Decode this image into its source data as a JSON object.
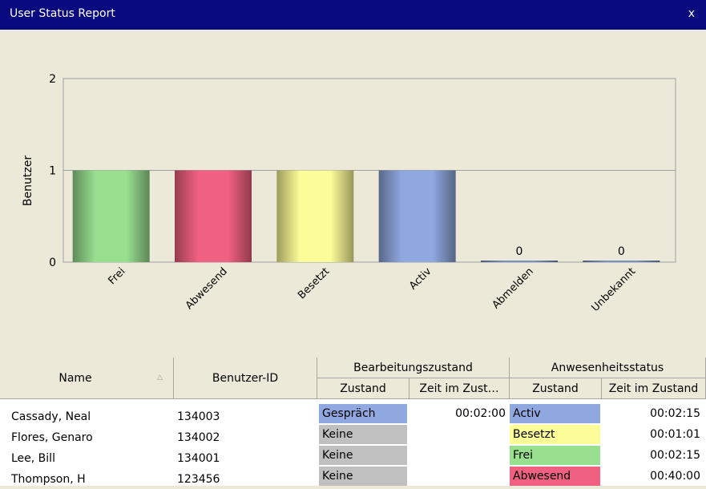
{
  "window": {
    "title": "User Status Report",
    "close_label": "x"
  },
  "chart_data": {
    "type": "bar",
    "categories": [
      "Frei",
      "Abwesend",
      "Besetzt",
      "Activ",
      "Abmelden",
      "Unbekannt"
    ],
    "values": [
      1,
      1,
      1,
      1,
      0,
      0
    ],
    "colors": [
      "#98e090",
      "#f06080",
      "#fcfc98",
      "#90a8e0",
      "#7890c0",
      "#7890c0"
    ],
    "data_labels": [
      "",
      "",
      "",
      "",
      "0",
      "0"
    ],
    "ylabel": "Benutzer",
    "ylim": [
      0,
      2
    ],
    "yticks": [
      "0",
      "1",
      "2"
    ],
    "grid": true
  },
  "table": {
    "headers": {
      "name": "Name",
      "user_id": "Benutzer-ID",
      "group_processing": "Bearbeitungszustand",
      "group_presence": "Anwesenheitsstatus",
      "state": "Zustand",
      "time_in_state_truncated": "Zeit im Zust…",
      "presence_state": "Zustand",
      "presence_time": "Zeit im Zustand"
    },
    "sort_icon": "sort-ascending-icon",
    "rows": [
      {
        "name": "Cassady, Neal",
        "id": "134003",
        "state": "Gespräch",
        "state_time": "00:02:00",
        "state_color": "#90a8e0",
        "presence": "Activ",
        "presence_time": "00:02:15",
        "presence_color": "#90a8e0"
      },
      {
        "name": "Flores, Genaro",
        "id": "134002",
        "state": "Keine",
        "state_time": "",
        "state_color": "#c0c0c0",
        "presence": "Besetzt",
        "presence_time": "00:01:01",
        "presence_color": "#fcfc98"
      },
      {
        "name": "Lee, Bill",
        "id": "134001",
        "state": "Keine",
        "state_time": "",
        "state_color": "#c0c0c0",
        "presence": "Frei",
        "presence_time": "00:02:15",
        "presence_color": "#98e090"
      },
      {
        "name": "Thompson, H",
        "id": "123456",
        "state": "Keine",
        "state_time": "",
        "state_color": "#c0c0c0",
        "presence": "Abwesend",
        "presence_time": "00:40:00",
        "presence_color": "#f06080"
      }
    ]
  }
}
